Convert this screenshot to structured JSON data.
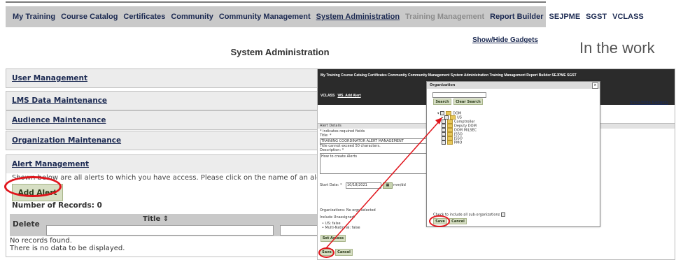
{
  "nav": {
    "items": [
      "My Training",
      "Course Catalog",
      "Certificates",
      "Community",
      "Community Management",
      "System Administration",
      "Training Management",
      "Report Builder",
      "SEJPME",
      "SGST",
      "VCLASS"
    ],
    "active": "System Administration",
    "disabled": "Training Management"
  },
  "header": {
    "show_hide": "Show/Hide Gadgets",
    "page_title": "System Administration",
    "side_note": "In the work"
  },
  "panels": {
    "user_management": "User Management",
    "lms_data": "LMS Data Maintenance",
    "audience": "Audience Maintenance",
    "organization": "Organization Maintenance",
    "alert": "Alert Management"
  },
  "alert": {
    "description": "Shown below are all alerts to which you have access. Please click on the name of an alert to edit.",
    "add_button": "Add Alert",
    "records": "Number of Records: 0",
    "table": {
      "delete_header": "Delete",
      "title_header": "Title ⇕"
    },
    "no_records": "No records found.",
    "no_data": "There is no data to be displayed."
  },
  "inset": {
    "nav_row1": "My Training  Course Catalog  Certificates  Community  Community Management  System Administration  Training Management  Report Builder  SEJPME  SGST",
    "nav_row2_a": "VCLASS",
    "nav_row2_b": "WS_Add Alert",
    "show_hide": "Show/Hide Gadgets",
    "alert_details": "Alert Details",
    "required_note": "* indicates required fields",
    "title_label": "Title: *",
    "title_value": "TRAINING COORDINATOR ALERT MANAGEMENT",
    "title_hint": "Title cannot exceed 50 characters.",
    "desc_label": "Description: *",
    "desc_value": "How to create Alerts",
    "start_date_label": "Start Date: *",
    "start_date_value": "10/18/2021",
    "date_format": "mm/dd",
    "orgs": "Organizations: No orgs selected",
    "include_unassigned": "Include Unassigned:",
    "us_false": "US: false",
    "multinational_false": "Multi-National: false",
    "set_access": "Set Access",
    "save": "Save",
    "cancel": "Cancel"
  },
  "org_dialog": {
    "title": "Organization",
    "close": "×",
    "search": "Search",
    "clear_search": "Clear Search",
    "tree": [
      "DOM",
      "US",
      "Comptroller",
      "Deputy DOM",
      "DOM MILSEC",
      "JSSO",
      "JSSO",
      "PMO"
    ],
    "include_sub": "Check to include all sub-organizations",
    "save": "Save",
    "cancel": "Cancel"
  },
  "annotations": {
    "highlight_color": "#e0141b"
  }
}
